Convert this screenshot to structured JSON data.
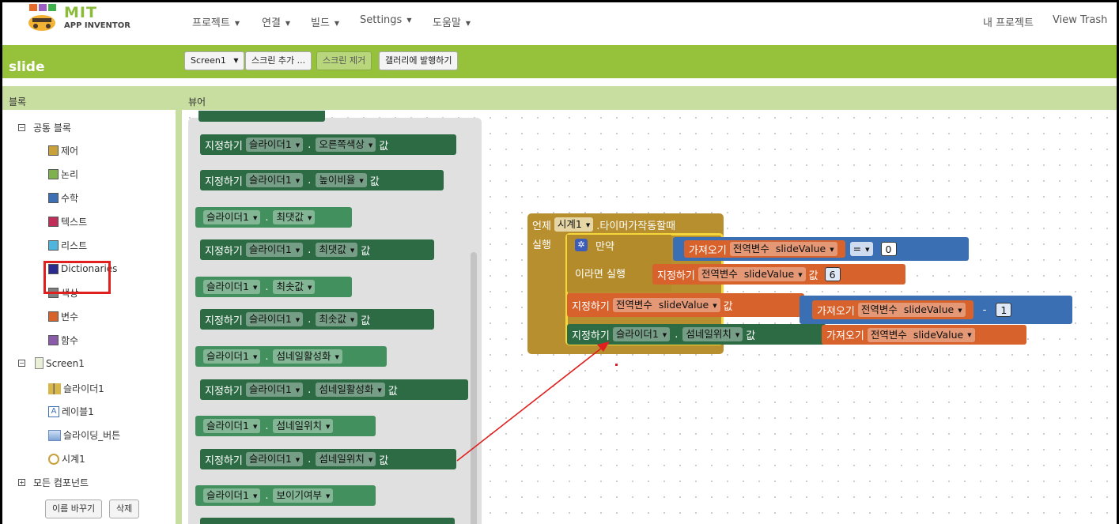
{
  "logo": {
    "mit": "MIT",
    "app_inventor": "APP INVENTOR"
  },
  "nav": {
    "projects": "프로젝트",
    "connect": "연결",
    "build": "빌드",
    "settings": "Settings",
    "help": "도움말",
    "my_projects": "내 프로젝트",
    "view_trash": "View Trash"
  },
  "project": {
    "name": "slide",
    "screen_select": "Screen1",
    "add_screen": "스크린 추가 ...",
    "remove_screen": "스크린 제거",
    "publish_gallery": "갤러리에 발행하기"
  },
  "panels": {
    "blocks_header": "블록",
    "viewer_header": "뷰어"
  },
  "tree": {
    "builtin": "공통 블록",
    "categories": [
      {
        "label": "제어",
        "color": "#c9a13b"
      },
      {
        "label": "논리",
        "color": "#7fb24e"
      },
      {
        "label": "수학",
        "color": "#3c6fb4"
      },
      {
        "label": "텍스트",
        "color": "#c02f5a"
      },
      {
        "label": "리스트",
        "color": "#50b5dc"
      },
      {
        "label": "Dictionaries",
        "color": "#2a2a8f"
      },
      {
        "label": "색상",
        "color": "#7f7f7f"
      },
      {
        "label": "변수",
        "color": "#d8622c"
      },
      {
        "label": "함수",
        "color": "#8a5ba8"
      }
    ],
    "screen": "Screen1",
    "components": [
      "슬라이더1",
      "레이블1",
      "슬라이딩_버튼",
      "시계1"
    ],
    "any_component": "모든 컴포넌트",
    "rename": "이름 바꾸기",
    "delete": "삭제"
  },
  "blocks": {
    "set": "지정하기",
    "get": "가져오기",
    "to": "값",
    "component": "슬라이더1",
    "props": {
      "right_color": "오른쪽색상",
      "height_percent": "높이비율",
      "max": "최댓값",
      "min": "최솟값",
      "thumb_enabled": "섬네일활성화",
      "thumb_position": "섬네일위치",
      "visible": "보이기여부"
    },
    "event": {
      "when": "언제",
      "timer_comp": "시계1",
      "timer_event": ".타이머가작동할때",
      "do": "실행",
      "if": "만약",
      "then_do": "이라면  실행",
      "global_var": "전역변수",
      "var_name": "slideValue",
      "eq": "=",
      "zero": "0",
      "six": "6",
      "minus": "-",
      "one": "1"
    }
  }
}
